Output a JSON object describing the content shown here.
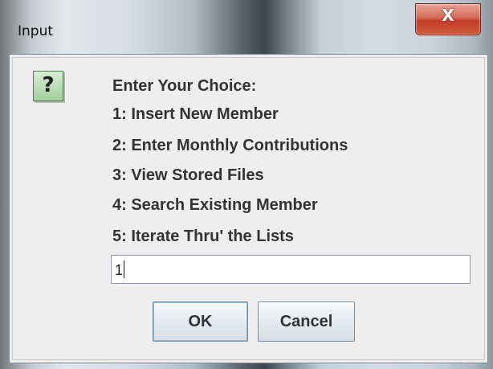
{
  "window": {
    "title": "Input",
    "close_glyph": "X"
  },
  "icon": {
    "type": "question-icon",
    "glyph": "?"
  },
  "message": {
    "lines": [
      "Enter Your Choice:",
      "1: Insert New Member",
      "2: Enter Monthly Contributions",
      "3: View Stored Files",
      "4: Search Existing Member",
      "5: Iterate Thru' the Lists"
    ]
  },
  "input": {
    "value": "1"
  },
  "buttons": {
    "ok_label": "OK",
    "cancel_label": "Cancel"
  },
  "colors": {
    "close_button": "#c23c26",
    "icon_fill": "#a3cf9e",
    "dialog_bg": "#eeeeee"
  }
}
